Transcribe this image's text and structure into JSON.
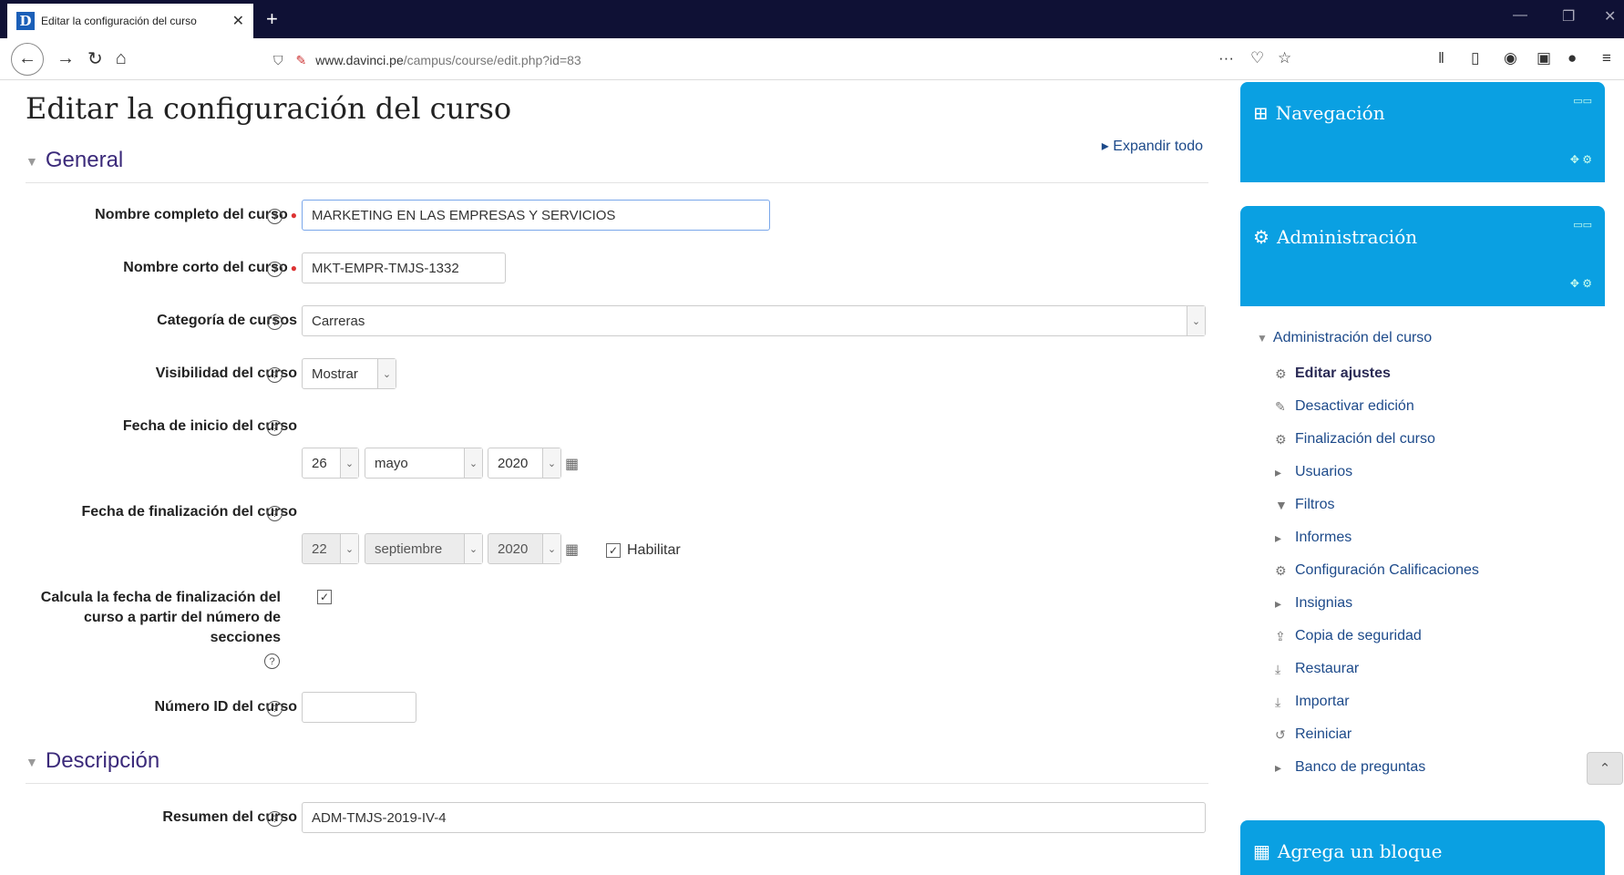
{
  "browser": {
    "tab_title": "Editar la configuración del curso",
    "url_domain": "www.davinci.pe",
    "url_path": "/campus/course/edit.php?id=83"
  },
  "page": {
    "title": "Editar la configuración del curso",
    "expand_all": "Expandir todo",
    "section_general": "General",
    "section_description": "Descripción"
  },
  "form": {
    "fullname_label": "Nombre completo del curso",
    "fullname_value": "MARKETING EN LAS EMPRESAS Y SERVICIOS",
    "shortname_label": "Nombre corto del curso",
    "shortname_value": "MKT-EMPR-TMJS-1332",
    "category_label": "Categoría de cursos",
    "category_value": "Carreras",
    "visibility_label": "Visibilidad del curso",
    "visibility_value": "Mostrar",
    "startdate_label": "Fecha de inicio del curso",
    "start_day": "26",
    "start_month": "mayo",
    "start_year": "2020",
    "enddate_label": "Fecha de finalización del curso",
    "end_day": "22",
    "end_month": "septiembre",
    "end_year": "2020",
    "enable_label": "Habilitar",
    "calc_label_1": "Calcula la fecha de finalización del",
    "calc_label_2": "curso a partir del número de",
    "calc_label_3": "secciones",
    "idnumber_label": "Número ID del curso",
    "summary_label": "Resumen del curso",
    "summary_value": "ADM-TMJS-2019-IV-4"
  },
  "sidebar": {
    "nav_title": "Navegación",
    "admin_title": "Administración",
    "admin_course": "Administración del curso",
    "items": [
      {
        "label": "Editar ajustes",
        "icon": "gear-icon"
      },
      {
        "label": "Desactivar edición",
        "icon": "pencil-icon"
      },
      {
        "label": "Finalización del curso",
        "icon": "gear-icon"
      },
      {
        "label": "Usuarios",
        "icon": "caret-icon"
      },
      {
        "label": "Filtros",
        "icon": "filter-icon"
      },
      {
        "label": "Informes",
        "icon": "caret-icon"
      },
      {
        "label": "Configuración Calificaciones",
        "icon": "gear-icon"
      },
      {
        "label": "Insignias",
        "icon": "caret-icon"
      },
      {
        "label": "Copia de seguridad",
        "icon": "upload-icon"
      },
      {
        "label": "Restaurar",
        "icon": "download-icon"
      },
      {
        "label": "Importar",
        "icon": "download-icon"
      },
      {
        "label": "Reiniciar",
        "icon": "reset-icon"
      },
      {
        "label": "Banco de preguntas",
        "icon": "caret-icon"
      }
    ],
    "add_block": "Agrega un bloque"
  }
}
